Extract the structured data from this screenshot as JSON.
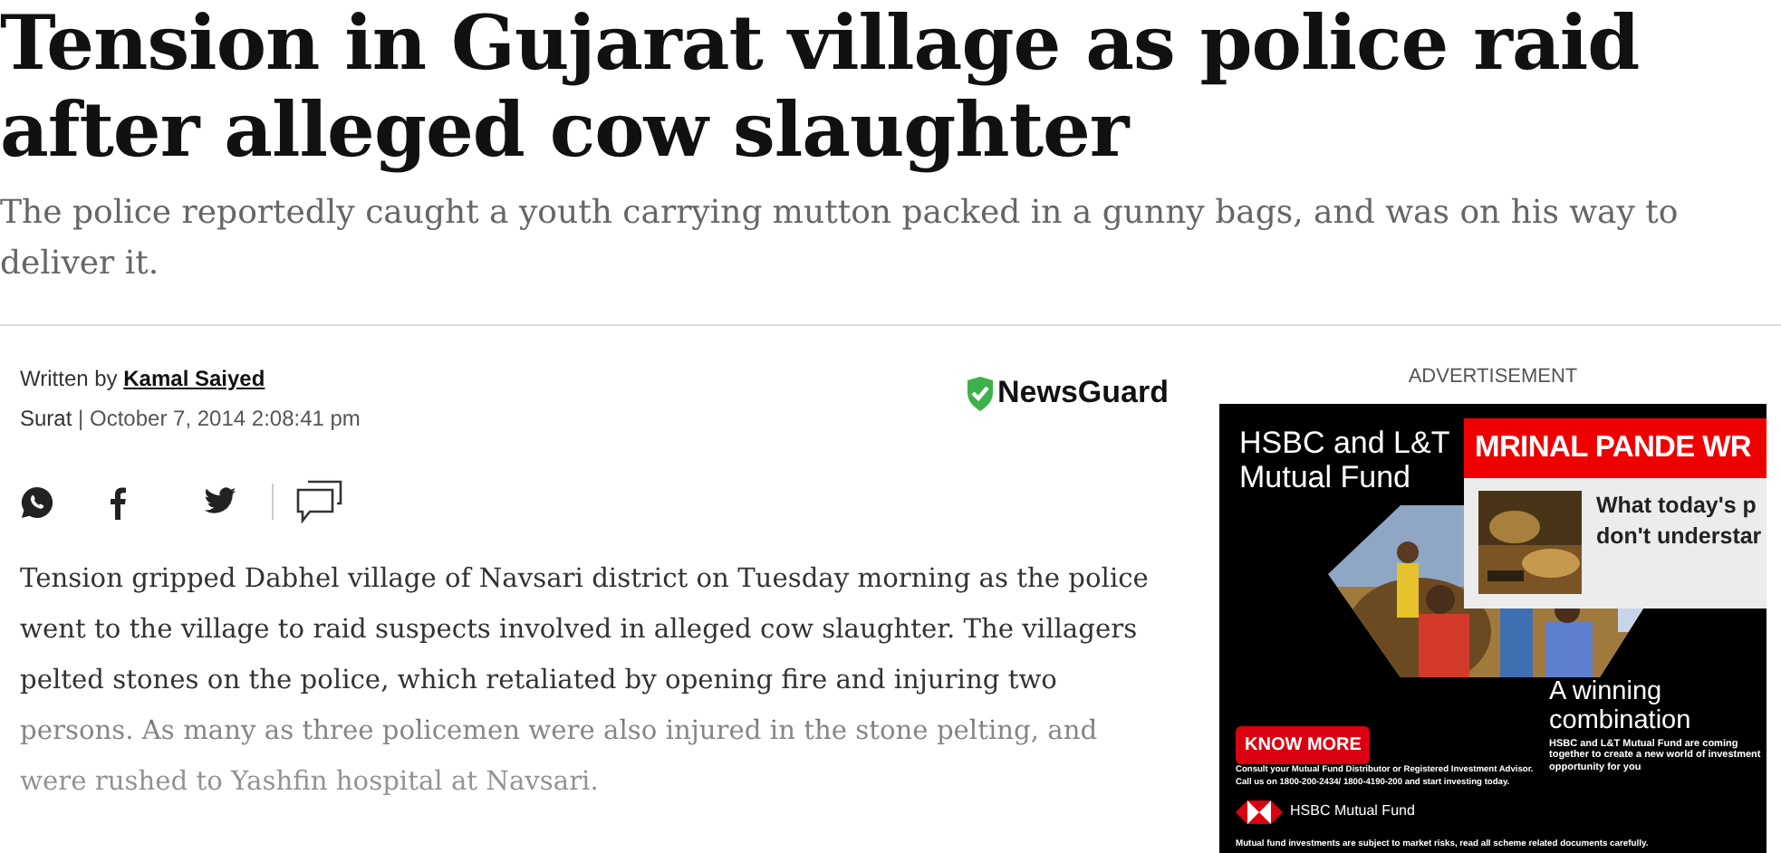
{
  "headline": "Tension in Gujarat village as police raid after alleged cow slaughter",
  "subheadline": "The police reportedly caught a youth carrying mutton packed in a gunny bags, and was on his way to deliver it.",
  "byline": {
    "prefix": "Written by",
    "author": "Kamal Saiyed",
    "location": "Surat",
    "separator": "|",
    "date": "October 7, 2014 2:08:41 pm"
  },
  "newsguard": {
    "label": "NewsGuard"
  },
  "article": {
    "paragraph": "Tension gripped Dabhel village of Navsari district on Tuesday morning as the police went to the village to raid suspects involved in alleged cow slaughter. The villagers pelted stones on the police, which retaliated by opening fire and injuring two persons. As many as three policemen were also injured in the stone pelting, and were rushed to Yashfin hospital at Navsari."
  },
  "advertisement": {
    "label": "ADVERTISEMENT",
    "title_lines": [
      "HSBC and L&T",
      "Mutual Fund"
    ],
    "heading_lines": [
      "A winning",
      "combination"
    ],
    "blurb": "HSBC and L&T Mutual Fund are coming together to create a new world of investment opportunity for you",
    "button": "KNOW MORE",
    "disclaimer": "Consult your Mutual Fund Distributor or Registered Investment Advisor. Call us on 1800-200-2434/ 1800-4190-200 and start investing today.",
    "brand": "HSBC Mutual Fund",
    "footer": "Mutual fund investments are subject to market risks, read all scheme related documents carefully."
  },
  "overlay": {
    "kicker": "MRINAL PANDE WR",
    "title_lines": [
      "What today's p",
      "don't understar"
    ]
  }
}
